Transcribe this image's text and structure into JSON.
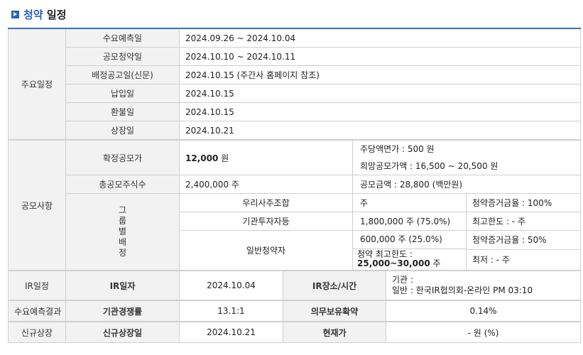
{
  "title": {
    "accent": "청약",
    "rest": " 일정"
  },
  "schedule": {
    "section": "주요일정",
    "rows": [
      {
        "label": "수요예측일",
        "value": "2024.09.26 ~ 2024.10.04"
      },
      {
        "label": "공모청약일",
        "value": "2024.10.10 ~ 2024.10.11"
      },
      {
        "label": "배정공고일(신문)",
        "value": "2024.10.15 (주간사 홈페이지 참조)"
      },
      {
        "label": "납입일",
        "value": "2024.10.15"
      },
      {
        "label": "환불일",
        "value": "2024.10.15"
      },
      {
        "label": "상장일",
        "value": "2024.10.21"
      }
    ]
  },
  "offering": {
    "section": "공모사항",
    "confirmed_price_label": "확정공모가",
    "confirmed_price_number": "12,000",
    "confirmed_price_unit": " 원",
    "par_value": "주당액면가 : 500 원",
    "desired_price": "희망공모가액 : 16,500 ~ 20,500 원",
    "total_shares_label": "총공모주식수",
    "total_shares_value": "2,400,000 주",
    "total_amount": "공모금액 : 28,800 (백만원)",
    "group_label_chars": [
      "그",
      "룹",
      "별",
      "배",
      "정"
    ],
    "groups": [
      {
        "name": "우리사주조합",
        "shares": "주",
        "note": "청약증거금율 : 100%"
      },
      {
        "name": "기관투자자등",
        "shares": "1,800,000 주 (75.0%)",
        "note": "최고한도 : - 주"
      },
      {
        "name": "일반청약자",
        "shares": "600,000 주 (25.0%)",
        "note": "청약증거금율 : 50%",
        "max_label": "청약 최고한도 :",
        "max_value": "25,000~30,000",
        "max_unit": " 주",
        "min_note": "최저 : - 주"
      }
    ]
  },
  "ir": {
    "section": "IR일정",
    "date_label": "IR일자",
    "date_value": "2024.10.04",
    "place_label": "IR장소/시간",
    "place_line1": "기관 :",
    "place_line2": "일반 : 한국IR협의회-온라인 PM 03:10"
  },
  "forecast": {
    "section": "수요예측결과",
    "competition_label": "기관경쟁률",
    "competition_value": "13.1:1",
    "lockup_label": "의무보유확약",
    "lockup_value": "0.14%"
  },
  "listing": {
    "section": "신규상장",
    "date_label": "신규상장일",
    "date_value": "2024.10.21",
    "price_label": "현재가",
    "price_value": "- 원 (%)"
  }
}
